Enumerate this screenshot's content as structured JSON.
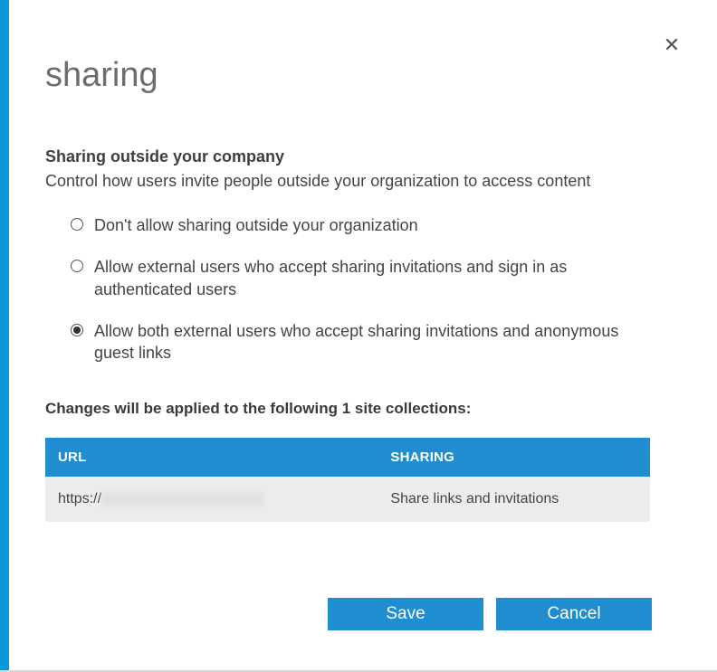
{
  "title": "sharing",
  "close_label": "✕",
  "section": {
    "heading": "Sharing outside your company",
    "description": "Control how users invite people outside your organization to access content"
  },
  "options": [
    {
      "label": "Don't allow sharing outside your organization",
      "selected": false
    },
    {
      "label": "Allow external users who accept sharing invitations and sign in as authenticated users",
      "selected": false
    },
    {
      "label": "Allow both external users who accept sharing invitations and anonymous guest links",
      "selected": true
    }
  ],
  "changes_heading": "Changes will be applied to the following 1 site collections:",
  "table": {
    "headers": {
      "url": "URL",
      "sharing": "SHARING"
    },
    "rows": [
      {
        "url_prefix": "https://",
        "url_rest_redacted": true,
        "sharing": "Share links and invitations"
      }
    ]
  },
  "buttons": {
    "save": "Save",
    "cancel": "Cancel"
  }
}
